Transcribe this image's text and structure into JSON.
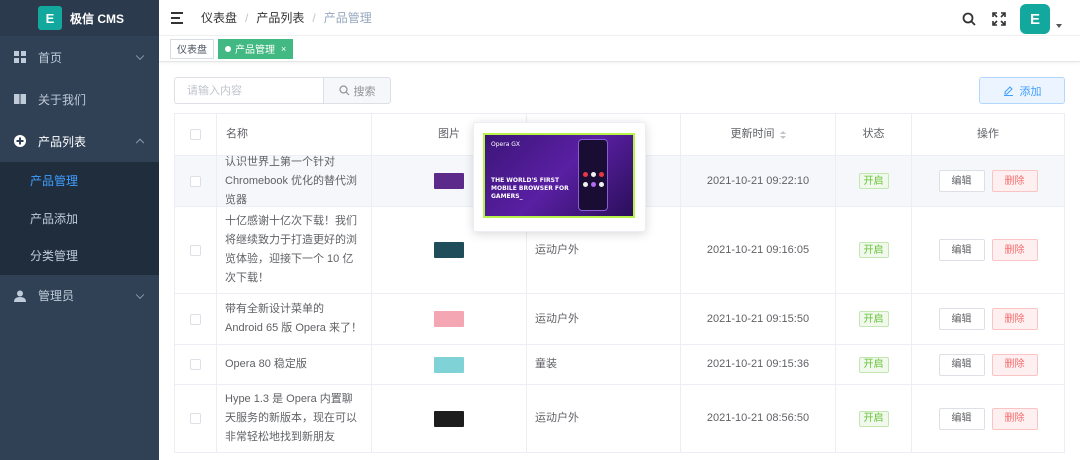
{
  "app": {
    "title": "极信 CMS",
    "logo_glyph": "E"
  },
  "sidebar": {
    "items": [
      {
        "label": "首页",
        "icon": "grid-icon"
      },
      {
        "label": "关于我们",
        "icon": "book-icon"
      },
      {
        "label": "产品列表",
        "icon": "plus-circle-icon",
        "expanded": true,
        "children": [
          {
            "label": "产品管理",
            "active": true
          },
          {
            "label": "产品添加"
          },
          {
            "label": "分类管理"
          }
        ]
      },
      {
        "label": "管理员",
        "icon": "user-icon"
      }
    ]
  },
  "breadcrumb": [
    "仪表盘",
    "产品列表",
    "产品管理"
  ],
  "tags": [
    {
      "label": "仪表盘"
    },
    {
      "label": "产品管理",
      "active": true
    }
  ],
  "toolbar": {
    "search_placeholder": "请输入内容",
    "search_label": "搜索",
    "add_label": "添加"
  },
  "table": {
    "headers": {
      "name": "名称",
      "image": "图片",
      "category": "",
      "updated": "更新时间",
      "status": "状态",
      "ops": "操作"
    },
    "rows": [
      {
        "name": "认识世界上第一个针对 Chromebook 优化的替代浏览器",
        "category": "",
        "updated": "2021-10-21 09:22:10",
        "status": "开启",
        "thumb": "#5b2a8a"
      },
      {
        "name": "十亿感谢十亿次下载！我们将继续致力于打造更好的浏览体验，迎接下一个 10 亿次下载！",
        "category": "运动户外",
        "updated": "2021-10-21 09:16:05",
        "status": "开启",
        "thumb": "#1f4e5a"
      },
      {
        "name": "带有全新设计菜单的 Android 65 版 Opera 来了！",
        "category": "运动户外",
        "updated": "2021-10-21 09:15:50",
        "status": "开启",
        "thumb": "#f4a6b3"
      },
      {
        "name": "Opera 80 稳定版",
        "category": "童装",
        "updated": "2021-10-21 09:15:36",
        "status": "开启",
        "thumb": "#7fd3d6"
      },
      {
        "name": "Hype 1.3 是 Opera 内置聊天服务的新版本，现在可以非常轻松地找到新朋友",
        "category": "运动户外",
        "updated": "2021-10-21 08:56:50",
        "status": "开启",
        "thumb": "#1d1d1d"
      }
    ],
    "edit_label": "编辑",
    "delete_label": "删除"
  },
  "popover": {
    "brand": "Opera GX",
    "headline": "THE WORLD'S FIRST MOBILE BROWSER FOR GAMERS_"
  },
  "colors": {
    "sidebar": "#304156",
    "accent": "#409eff",
    "brand": "#13a89e",
    "tag_active": "#42b983"
  }
}
